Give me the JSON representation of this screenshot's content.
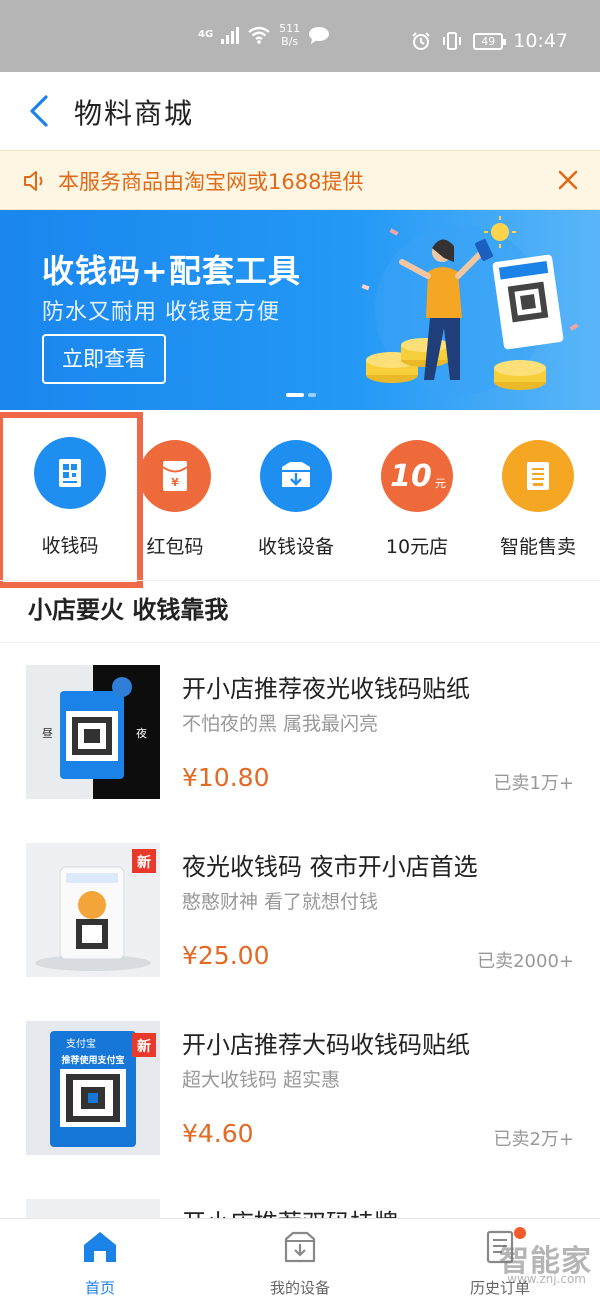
{
  "status_bar": {
    "network": "4G",
    "speed_value": "511",
    "speed_unit": "B/s",
    "battery": "49",
    "time": "10:47"
  },
  "header": {
    "title": "物料商城"
  },
  "notice": {
    "text": "本服务商品由淘宝网或1688提供"
  },
  "banner": {
    "title": "收钱码+配套工具",
    "subtitle": "防水又耐用 收钱更方便",
    "button": "立即查看",
    "slide_count": 2,
    "active_slide": 1
  },
  "categories": [
    {
      "label": "收钱码",
      "icon": "qrcode-icon",
      "color": "#1e8ff0",
      "selected": true
    },
    {
      "label": "红包码",
      "icon": "red-envelope-icon",
      "color": "#ef6a3a"
    },
    {
      "label": "收钱设备",
      "icon": "device-icon",
      "color": "#1e8ff0"
    },
    {
      "label": "10元店",
      "icon": "ten-yuan-icon",
      "icon_text": "10",
      "icon_unit": "元",
      "color": "#ef6a3a"
    },
    {
      "label": "智能售卖",
      "icon": "vending-icon",
      "color": "#f5a623"
    }
  ],
  "section": {
    "title": "小店要火 收钱靠我"
  },
  "products": [
    {
      "title": "开小店推荐夜光收钱码贴纸",
      "subtitle": "不怕夜的黑 属我最闪亮",
      "price": "¥10.80",
      "sold": "已卖1万+",
      "img_day": "昼",
      "img_night": "夜"
    },
    {
      "title": "夜光收钱码 夜市开小店首选",
      "subtitle": "憨憨财神 看了就想付钱",
      "price": "¥25.00",
      "sold": "已卖2000+",
      "badge": "新"
    },
    {
      "title": "开小店推荐大码收钱码贴纸",
      "subtitle": "超大收钱码 超实惠",
      "price": "¥4.60",
      "sold": "已卖2万+",
      "badge": "新",
      "img_brand": "支付宝",
      "img_tagline": "推荐使用支付宝"
    },
    {
      "title": "开小店推荐双码挂牌"
    }
  ],
  "tabbar": [
    {
      "label": "首页",
      "icon": "home-icon",
      "active": true
    },
    {
      "label": "我的设备",
      "icon": "device-box-icon"
    },
    {
      "label": "历史订单",
      "icon": "order-list-icon",
      "has_dot": true
    }
  ],
  "watermark": {
    "text": "智能家",
    "sub": "www.znj.com"
  },
  "colors": {
    "accent": "#1b82e8",
    "price": "#e36a24",
    "highlight_box": "#f06a4a"
  }
}
